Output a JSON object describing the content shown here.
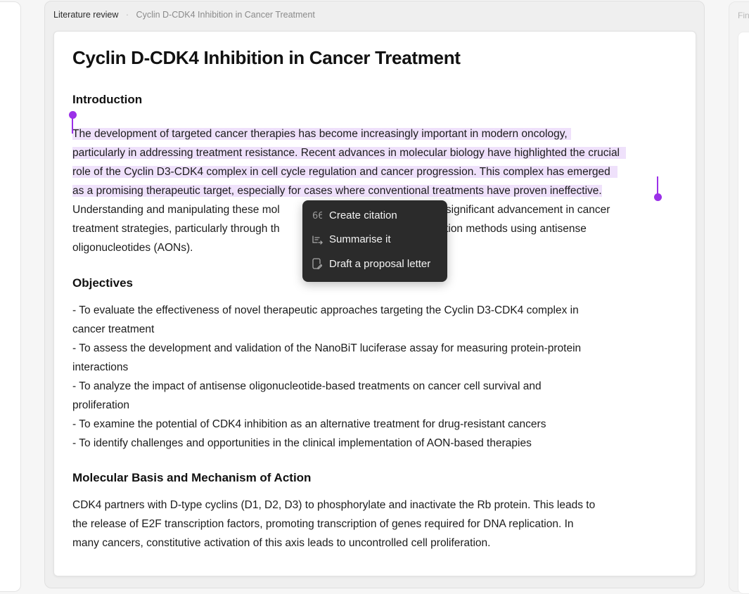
{
  "breadcrumb": {
    "root": "Literature review",
    "separator": "·",
    "page": "Cyclin D-CDK4 Inhibition in Cancer Treatment"
  },
  "right_panel": {
    "label": "Fin"
  },
  "document": {
    "title": "Cyclin D-CDK4 Inhibition in Cancer Treatment",
    "sections": [
      {
        "heading": "Introduction",
        "lines": [
          "The development of targeted cancer therapies has become increasingly important in modern oncology,",
          "particularly in addressing treatment resistance. Recent advances in molecular biology have highlighted the crucial",
          "role of the Cyclin D3-CDK4 complex in cell cycle regulation and cancer progression. This complex has emerged",
          "as a promising therapeutic target, especially for cases where conventional treatments have proven ineffective.",
          "Understanding and manipulating these mol",
          "nts a significant advancement in cancer",
          "treatment strategies, particularly through th",
          "bition methods using antisense",
          "oligonucleotides (AONs)."
        ]
      },
      {
        "heading": "Objectives",
        "lines": [
          "- To evaluate the effectiveness of novel therapeutic approaches targeting the Cyclin D3-CDK4 complex in",
          "cancer treatment",
          "- To assess the development and validation of the NanoBiT luciferase assay for measuring protein-protein",
          "interactions",
          "- To analyze the impact of antisense oligonucleotide-based treatments on cancer cell survival and",
          "proliferation",
          "- To examine the potential of CDK4 inhibition as an alternative treatment for drug-resistant cancers",
          "- To identify challenges and opportunities in the clinical implementation of AON-based therapies"
        ]
      },
      {
        "heading": "Molecular Basis and Mechanism of Action",
        "lines": [
          "CDK4 partners with D-type cyclins (D1, D2, D3) to phosphorylate and inactivate the Rb protein. This leads to",
          "the release of E2F transcription factors, promoting transcription of genes required for DNA replication. In",
          "many cancers, constitutive activation of this axis leads to uncontrolled cell proliferation."
        ]
      }
    ]
  },
  "context_menu": {
    "items": [
      {
        "label": "Create citation",
        "icon": "quote-icon"
      },
      {
        "label": "Summarise it",
        "icon": "summarize-icon"
      },
      {
        "label": "Draft a proposal letter",
        "icon": "draft-letter-icon"
      }
    ]
  },
  "colors": {
    "selection_highlight": "#efe1fb",
    "selection_handle": "#9b30e8",
    "menu_background": "#2b2b2b"
  }
}
